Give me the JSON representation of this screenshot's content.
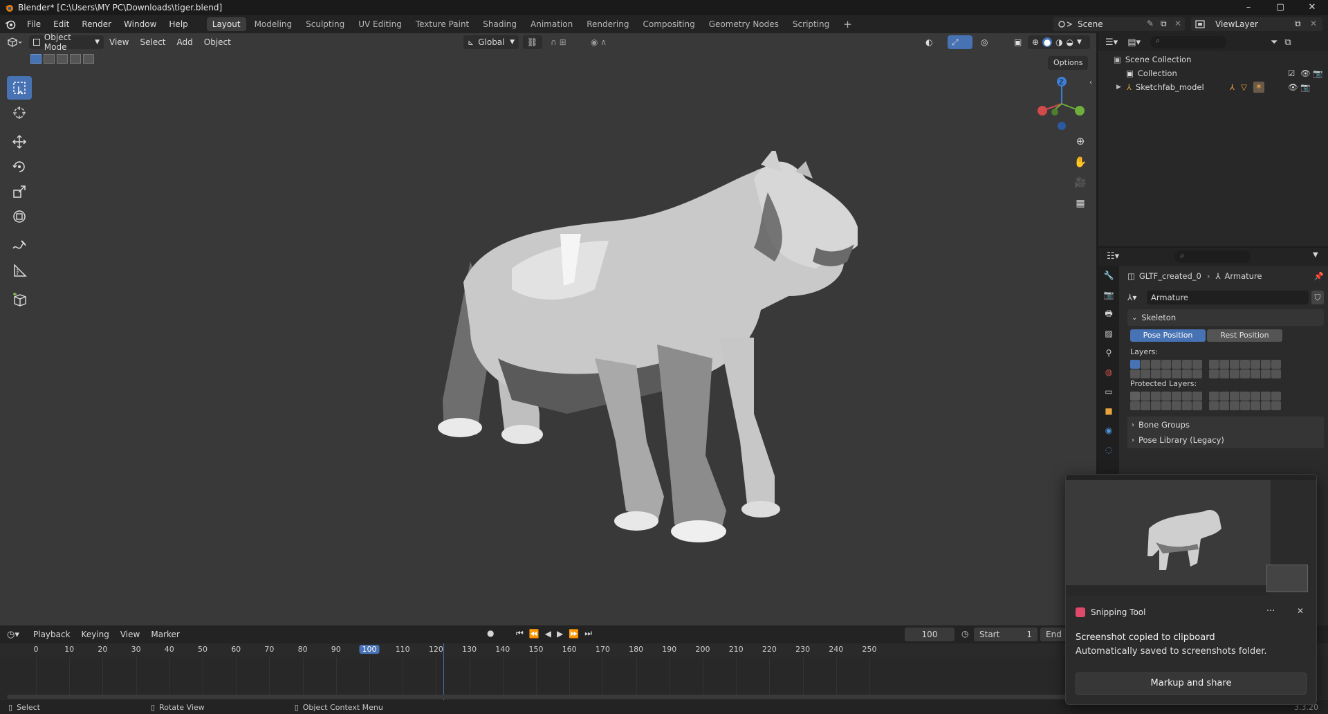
{
  "window": {
    "title": "Blender* [C:\\Users\\MY PC\\Downloads\\tiger.blend]",
    "controls": [
      "–",
      "▢",
      "✕"
    ]
  },
  "menu": {
    "items": [
      "File",
      "Edit",
      "Render",
      "Window",
      "Help"
    ],
    "workspaces": [
      "Layout",
      "Modeling",
      "Sculpting",
      "UV Editing",
      "Texture Paint",
      "Shading",
      "Animation",
      "Rendering",
      "Compositing",
      "Geometry Nodes",
      "Scripting"
    ],
    "active_workspace": "Layout",
    "add_tab": "+",
    "scene": "Scene",
    "view_layer": "ViewLayer"
  },
  "viewport": {
    "mode": "Object Mode",
    "menus": [
      "View",
      "Select",
      "Add",
      "Object"
    ],
    "orientation": "Global",
    "options": "Options",
    "gizmo_labels": {
      "z": "Z"
    },
    "icons": [
      "select-box-icon",
      "cursor-icon",
      "move-icon",
      "rotate-icon",
      "scale-icon",
      "transform-icon",
      "annotate-icon",
      "measure-icon",
      "add-cube-icon"
    ]
  },
  "outliner": {
    "rows": [
      {
        "label": "Scene Collection"
      },
      {
        "label": "Collection"
      },
      {
        "label": "Sketchfab_model"
      }
    ]
  },
  "properties": {
    "breadcrumb": [
      "GLTF_created_0",
      "Armature"
    ],
    "datablock": "Armature",
    "skeleton_panel": "Skeleton",
    "pose_position": "Pose Position",
    "rest_position": "Rest Position",
    "layers_label": "Layers:",
    "protected_label": "Protected Layers:",
    "bone_groups": "Bone Groups",
    "pose_library": "Pose Library (Legacy)"
  },
  "timeline": {
    "menus": [
      "Playback",
      "Keying",
      "View",
      "Marker"
    ],
    "current_frame": "100",
    "start_label": "Start",
    "start_value": "1",
    "end_label": "End",
    "ticks": [
      "0",
      "10",
      "20",
      "30",
      "40",
      "50",
      "60",
      "70",
      "80",
      "90",
      "100",
      "110",
      "120",
      "130",
      "140",
      "150",
      "160",
      "170",
      "180",
      "190",
      "200",
      "210",
      "220",
      "230",
      "240",
      "250"
    ]
  },
  "statusbar": {
    "select": "Select",
    "rotate": "Rotate View",
    "context": "Object Context Menu",
    "version": "3.3.20"
  },
  "toast": {
    "app": "Snipping Tool",
    "line1": "Screenshot copied to clipboard",
    "line2": "Automatically saved to screenshots folder.",
    "button": "Markup and share",
    "more": "···",
    "close": "✕"
  },
  "colors": {
    "accent": "#4772b3",
    "viewport_bg": "#393939",
    "panel_bg": "#2b2b2b",
    "gizmo_x": "#d24a4a",
    "gizmo_y": "#6fae3b",
    "gizmo_z": "#3f7ed5"
  }
}
